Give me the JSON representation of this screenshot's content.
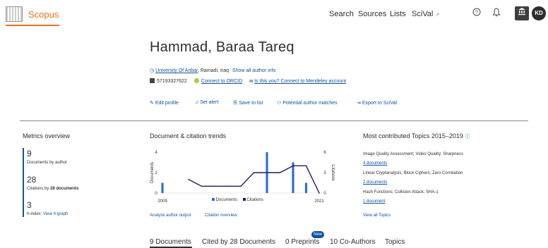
{
  "header": {
    "brand": "Scopus",
    "nav": [
      "Search",
      "Sources",
      "Lists",
      "SciVal"
    ],
    "scival_arrow": "↗",
    "help_icon": "help-icon",
    "bell_icon": "bell-icon",
    "institution_icon": "institution-icon",
    "avatar_initials": "KD"
  },
  "author": {
    "name": "Hammad, Baraa Tareq",
    "affiliation": "University Of Anbar",
    "location": ", Ramadi, Iraq",
    "show_all": "Show all author info",
    "author_id": "57193327622",
    "orcid_link": "Connect to ORCID",
    "mendeley_link": "Is this you? Connect to Mendeley account"
  },
  "actions": {
    "edit_profile": "Edit profile",
    "set_alert": "Set alert",
    "save_to_list": "Save to list",
    "potential_matches": "Potential author matches",
    "export_scival": "Export to SciVal"
  },
  "metrics": {
    "title": "Metrics overview",
    "documents": "9",
    "documents_label": "Documents by author",
    "citations": "28",
    "citations_label_prefix": "Citations by ",
    "citations_label_bold": "28 documents",
    "h_index": "3",
    "h_index_label": "h-index: ",
    "h_graph_link": "View h-graph"
  },
  "trends": {
    "title": "Document & citation trends",
    "analyze_link": "Analyze author output",
    "citation_overview_link": "Citation overview"
  },
  "chart_data": {
    "type": "bar",
    "x": [
      2009,
      2010,
      2011,
      2012,
      2013,
      2014,
      2015,
      2016,
      2017,
      2018,
      2019,
      2020,
      2021
    ],
    "series": [
      {
        "name": "Documents",
        "type": "bar",
        "values": [
          1,
          0,
          0,
          0,
          0,
          0,
          0,
          0,
          4,
          0,
          3,
          1,
          0
        ]
      },
      {
        "name": "Citations",
        "type": "line",
        "values": [
          null,
          null,
          2,
          1,
          1,
          1,
          1,
          3,
          3,
          3,
          4,
          4,
          0
        ]
      }
    ],
    "left_axis": {
      "label": "Documents",
      "ticks": [
        0,
        2,
        4
      ],
      "ylim": [
        0,
        4
      ]
    },
    "right_axis": {
      "label": "Citations",
      "ticks": [
        0,
        3,
        6
      ],
      "ylim": [
        0,
        6
      ]
    },
    "x_tick_labels": [
      "2009",
      "2021"
    ],
    "colors": {
      "Documents": "#2f6fd1",
      "Citations": "#1d1f5c"
    },
    "legend_placement": "bottom"
  },
  "topics": {
    "title": "Most contributed Topics 2015–2019",
    "items": [
      {
        "name": "Image Quality Assessment; Video Quality; Sharpness",
        "docs": "4 documents"
      },
      {
        "name": "Linear Cryptanalysis; Block Ciphers; Zero Correlation",
        "docs": "2 documents"
      },
      {
        "name": "Hash Functions; Collision Attack; SHA-1",
        "docs": "1 document"
      }
    ],
    "view_all": "View all Topics"
  },
  "tabs": [
    {
      "label": "9 Documents"
    },
    {
      "label": "Cited by 28 Documents"
    },
    {
      "label": "0 Preprints",
      "badge": "New"
    },
    {
      "label": "10 Co-Authors"
    },
    {
      "label": "Topics"
    }
  ]
}
